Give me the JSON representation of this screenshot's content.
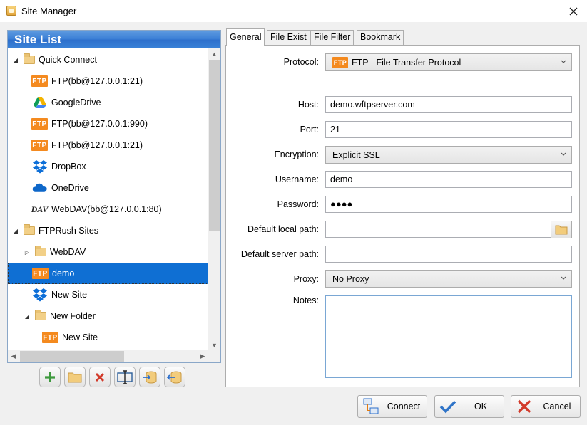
{
  "window": {
    "title": "Site Manager"
  },
  "site_list": {
    "header": "Site List",
    "items": [
      {
        "label": "Quick Connect",
        "kind": "folder",
        "expander": "open",
        "icon": "folder-icon"
      },
      {
        "label": "FTP(bb@127.0.0.1:21)",
        "kind": "ftp",
        "icon": "ftp-icon"
      },
      {
        "label": "GoogleDrive",
        "kind": "gdrive",
        "icon": "google-drive-icon"
      },
      {
        "label": "FTP(bb@127.0.0.1:990)",
        "kind": "ftp",
        "icon": "ftp-icon"
      },
      {
        "label": "FTP(bb@127.0.0.1:21)",
        "kind": "ftp",
        "icon": "ftp-icon"
      },
      {
        "label": "DropBox",
        "kind": "dropbox",
        "icon": "dropbox-icon"
      },
      {
        "label": "OneDrive",
        "kind": "onedrive",
        "icon": "onedrive-icon"
      },
      {
        "label": "WebDAV(bb@127.0.0.1:80)",
        "kind": "dav",
        "icon": "webdav-icon",
        "icon_text": "DAV"
      },
      {
        "label": "FTPRush Sites",
        "kind": "folder",
        "expander": "open",
        "icon": "folder-icon"
      },
      {
        "label": "WebDAV",
        "kind": "folder",
        "expander": "closed",
        "icon": "folder-icon"
      },
      {
        "label": "demo",
        "kind": "ftp",
        "icon": "ftp-icon",
        "selected": true
      },
      {
        "label": "New Site",
        "kind": "dropbox",
        "icon": "dropbox-icon"
      },
      {
        "label": "New Folder",
        "kind": "folder",
        "expander": "open",
        "icon": "folder-icon"
      },
      {
        "label": "New Site",
        "kind": "ftp",
        "icon": "ftp-icon"
      }
    ],
    "ftp_icon_text": "FTP"
  },
  "toolbar": [
    {
      "name": "add-site-button",
      "icon": "plus-icon"
    },
    {
      "name": "add-folder-button",
      "icon": "folder-icon"
    },
    {
      "name": "delete-button",
      "icon": "delete-x-icon"
    },
    {
      "name": "rename-button",
      "icon": "rename-icon"
    },
    {
      "name": "import-button",
      "icon": "import-icon"
    },
    {
      "name": "export-button",
      "icon": "export-icon"
    }
  ],
  "tabs": [
    {
      "label": "General",
      "active": true
    },
    {
      "label": "File Exist",
      "active": false
    },
    {
      "label": "File Filter",
      "active": false
    },
    {
      "label": "Bookmark",
      "active": false
    }
  ],
  "form": {
    "protocol": {
      "label": "Protocol:",
      "value": "FTP - File Transfer Protocol",
      "icon_text": "FTP"
    },
    "host": {
      "label": "Host:",
      "value": "demo.wftpserver.com"
    },
    "port": {
      "label": "Port:",
      "value": "21"
    },
    "encryption": {
      "label": "Encryption:",
      "value": "Explicit SSL"
    },
    "username": {
      "label": "Username:",
      "value": "demo"
    },
    "password": {
      "label": "Password:",
      "value": "●●●●"
    },
    "local_path": {
      "label": "Default local path:",
      "value": ""
    },
    "server_path": {
      "label": "Default server path:",
      "value": ""
    },
    "proxy": {
      "label": "Proxy:",
      "value": "No Proxy"
    },
    "notes": {
      "label": "Notes:",
      "value": ""
    }
  },
  "buttons": {
    "connect": "Connect",
    "ok": "OK",
    "cancel": "Cancel"
  },
  "colors": {
    "header_blue": "#3b7fd6",
    "selection": "#0f6fd3",
    "ftp_orange": "#f48a1f"
  }
}
